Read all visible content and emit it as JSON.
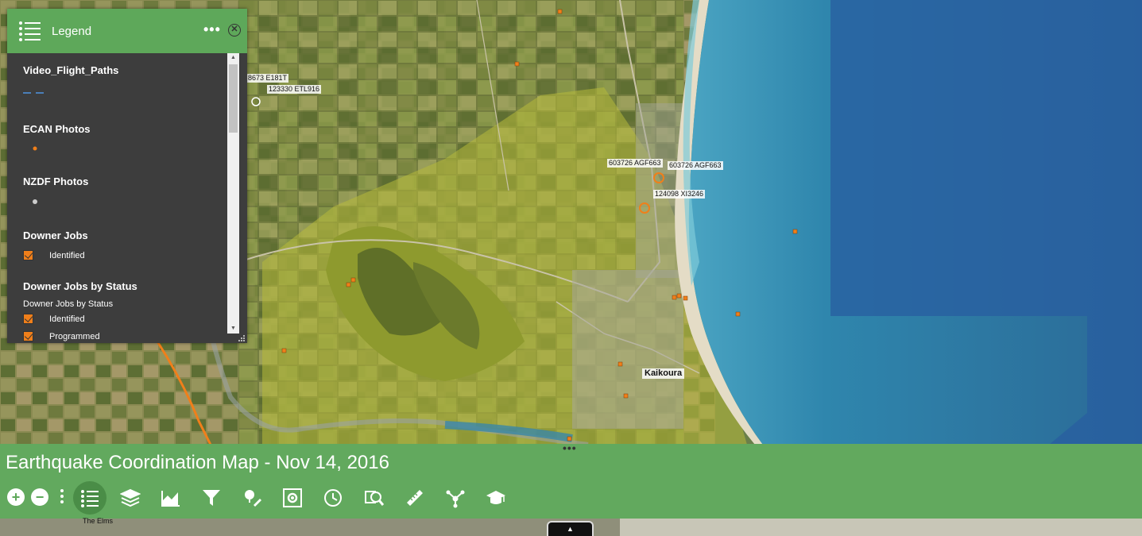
{
  "legend": {
    "title": "Legend",
    "more_label": "•••",
    "close_label": "✕",
    "layers": [
      {
        "name": "Video_Flight_Paths"
      },
      {
        "name": "ECAN Photos"
      },
      {
        "name": "NZDF Photos"
      },
      {
        "name": "Downer Jobs",
        "items": [
          "Identified"
        ]
      },
      {
        "name": "Downer Jobs by Status",
        "sublabel": "Downer Jobs by Status",
        "items": [
          "Identified",
          "Programmed"
        ]
      }
    ]
  },
  "map": {
    "labels": [
      "8673 E181T",
      "123330 ETL916",
      "603726 AGF663",
      "603726 AGF663",
      "124098 XI3246"
    ],
    "town": "Kaikoura",
    "bottom_place": "The Elms"
  },
  "app": {
    "title": "Earthquake Coordination Map - Nov 14, 2016"
  },
  "toolbar": {
    "zoom_in": "+",
    "zoom_out": "−",
    "tools": [
      "legend-icon",
      "layers-icon",
      "chart-icon",
      "filter-icon",
      "draw-icon",
      "screening-icon",
      "time-icon",
      "query-icon",
      "measure-icon",
      "network-icon",
      "education-icon"
    ]
  },
  "bottom_toggle": "▲",
  "colors": {
    "accent": "#5ea85a",
    "panel": "#3d3d3d",
    "marker": "#f07f1a",
    "flight_path": "#4a7fb8"
  }
}
